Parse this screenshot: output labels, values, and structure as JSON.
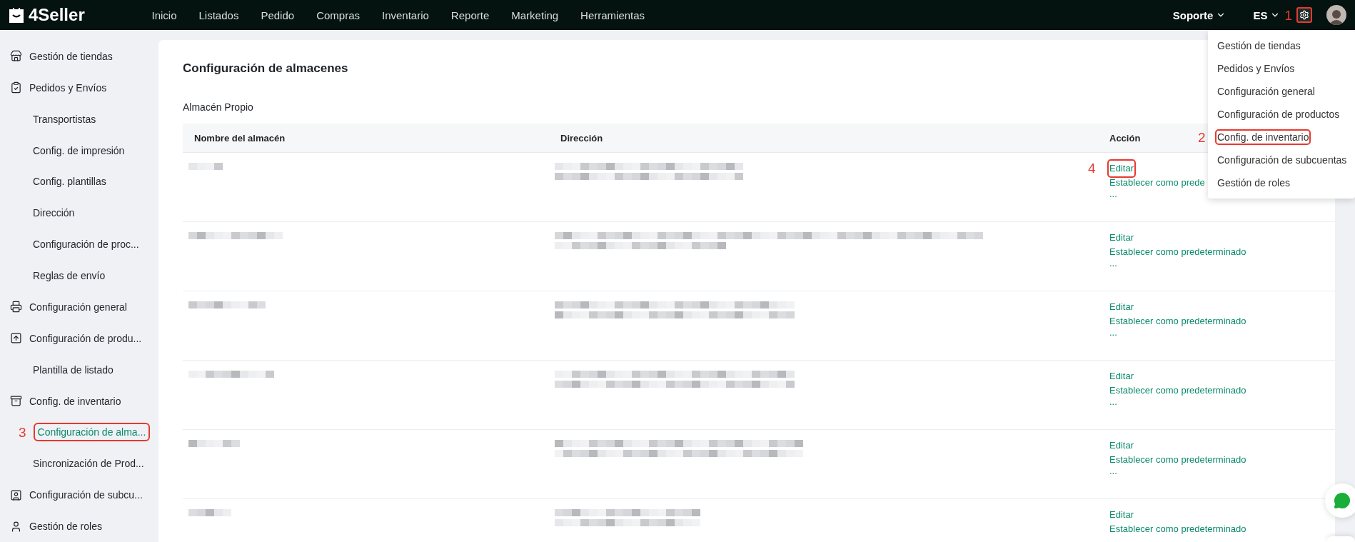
{
  "topbar": {
    "logo": "4Seller",
    "nav": [
      "Inicio",
      "Listados",
      "Pedido",
      "Compras",
      "Inventario",
      "Reporte",
      "Marketing",
      "Herramientas"
    ],
    "support": "Soporte",
    "language": "ES",
    "settings_callout": "1"
  },
  "settings_menu": [
    {
      "label": "Gestión de tiendas"
    },
    {
      "label": "Pedidos y Envíos"
    },
    {
      "label": "Configuración general"
    },
    {
      "label": "Configuración de productos"
    },
    {
      "label": "Config. de inventario",
      "callout": "2"
    },
    {
      "label": "Configuración de subcuentas"
    },
    {
      "label": "Gestión de roles"
    }
  ],
  "sidebar": [
    {
      "kind": "store",
      "label": "Gestión de tiendas",
      "selected": false
    },
    {
      "kind": "orders",
      "label": "Pedidos y Envíos",
      "selected": false,
      "children": [
        {
          "label": "Transportistas",
          "selected": false
        },
        {
          "label": "Config. de impresión",
          "selected": false
        },
        {
          "label": "Config. plantillas",
          "selected": false
        },
        {
          "label": "Dirección",
          "selected": false
        },
        {
          "label": "Configuración de proc...",
          "selected": false
        },
        {
          "label": "Reglas de envío",
          "selected": false
        }
      ]
    },
    {
      "kind": "printer",
      "label": "Configuración general",
      "selected": false
    },
    {
      "kind": "upload",
      "label": "Configuración de produ...",
      "selected": false,
      "children": [
        {
          "label": "Plantilla de listado",
          "selected": false
        }
      ]
    },
    {
      "kind": "inventory",
      "label": "Config. de inventario",
      "selected": false,
      "children": [
        {
          "label": "Configuración de alma...",
          "selected": true,
          "callout": "3"
        },
        {
          "label": "Sincronización de Prod...",
          "selected": false
        }
      ]
    },
    {
      "kind": "badge",
      "label": "Configuración de subcu...",
      "selected": false
    },
    {
      "kind": "user",
      "label": "Gestión de roles",
      "selected": false
    }
  ],
  "page": {
    "title": "Configuración de almacenes",
    "section": "Almacén Propio",
    "columns": [
      "Nombre del almacén",
      "Dirección",
      "Acción"
    ],
    "rows": [
      {
        "edit": "Editar",
        "set_default": "Establecer como prede",
        "more": "...",
        "callout": "4"
      },
      {
        "edit": "Editar",
        "set_default": "Establecer como predeterminado",
        "more": "..."
      },
      {
        "edit": "Editar",
        "set_default": "Establecer como predeterminado",
        "more": "..."
      },
      {
        "edit": "Editar",
        "set_default": "Establecer como predeterminado",
        "more": "..."
      },
      {
        "edit": "Editar",
        "set_default": "Establecer como predeterminado",
        "more": "..."
      },
      {
        "edit": "Editar",
        "set_default": "Establecer como predeterminado"
      }
    ]
  }
}
